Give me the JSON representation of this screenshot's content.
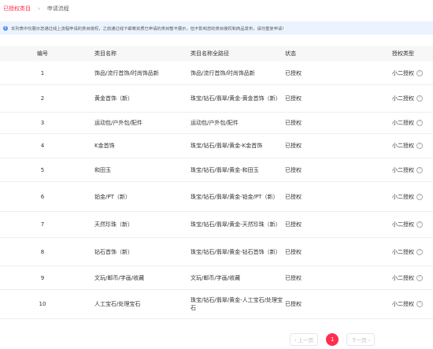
{
  "breadcrumb": {
    "active": "已授权类目",
    "separator": "›",
    "current": "申请流程"
  },
  "notice": {
    "icon": "info-icon",
    "text": "本列表中仅展示您通过线上流程申请的类目授权，之前通过线下邮寄资质已申请的类目暂不展示，但不影响您的类目授权和商品发布，请勿重复申请!"
  },
  "table": {
    "headers": [
      "编号",
      "类目名称",
      "类目名称全路径",
      "状态",
      "授权类型"
    ],
    "rows": [
      {
        "id": "1",
        "name": "饰品/流行首饰/时尚饰品新",
        "path": "饰品/流行首饰/时尚饰品新",
        "status": "已授权",
        "type": "小二授权"
      },
      {
        "id": "2",
        "name": "黄金首饰（新）",
        "path": "珠宝/钻石/翡翠/黄金-黄金首饰（新）",
        "status": "已授权",
        "type": "小二授权"
      },
      {
        "id": "3",
        "name": "运动包/户外包/配件",
        "path": "运动包/户外包/配件",
        "status": "已授权",
        "type": "小二授权"
      },
      {
        "id": "4",
        "name": "K金首饰",
        "path": "珠宝/钻石/翡翠/黄金-K金首饰",
        "status": "已授权",
        "type": "小二授权"
      },
      {
        "id": "5",
        "name": "和田玉",
        "path": "珠宝/钻石/翡翠/黄金-和田玉",
        "status": "已授权",
        "type": "小二授权"
      },
      {
        "id": "6",
        "name": "铂金/PT（新）",
        "path": "珠宝/钻石/翡翠/黄金-铂金/PT（新）",
        "status": "已授权",
        "type": "小二授权"
      },
      {
        "id": "7",
        "name": "天然珍珠（新）",
        "path": "珠宝/钻石/翡翠/黄金-天然珍珠（新）",
        "status": "已授权",
        "type": "小二授权"
      },
      {
        "id": "8",
        "name": "钻石首饰（新）",
        "path": "珠宝/钻石/翡翠/黄金-钻石首饰（新）",
        "status": "已授权",
        "type": "小二授权"
      },
      {
        "id": "9",
        "name": "文玩/邮币/字画/收藏",
        "path": "文玩/邮币/字画/收藏",
        "status": "已授权",
        "type": "小二授权"
      },
      {
        "id": "10",
        "name": "人工宝石/处理宝石",
        "path": "珠宝/钻石/翡翠/黄金-人工宝石/处理宝石",
        "status": "已授权",
        "type": "小二授权"
      }
    ]
  },
  "pagination": {
    "prev": "‹ 上一页",
    "current": "1",
    "next": "下一页 ›"
  },
  "colors": {
    "accent": "#ff2e4d",
    "notice_bg": "#ebf3ff",
    "header_bg": "#f7f7f7"
  }
}
